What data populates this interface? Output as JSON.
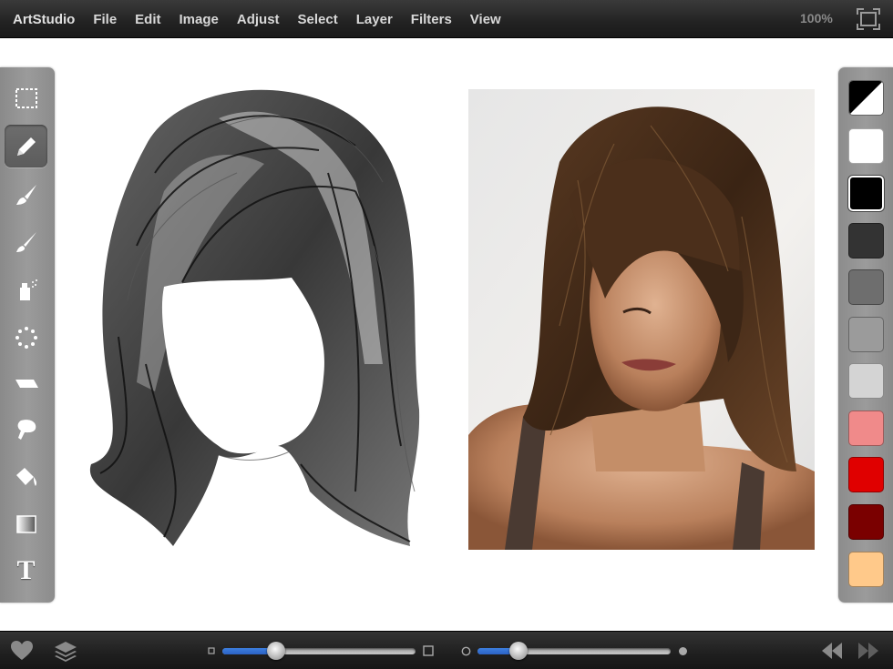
{
  "menubar": {
    "app_name": "ArtStudio",
    "items": [
      "File",
      "Edit",
      "Image",
      "Adjust",
      "Select",
      "Layer",
      "Filters",
      "View"
    ],
    "zoom": "100%",
    "fullscreen_icon": "fullscreen-icon"
  },
  "tools": [
    {
      "name": "selection-tool",
      "icon": "marquee-icon",
      "active": false
    },
    {
      "name": "pencil-tool",
      "icon": "pencil-icon",
      "active": true
    },
    {
      "name": "brush-tool",
      "icon": "brush-icon",
      "active": false
    },
    {
      "name": "smudge-brush-tool",
      "icon": "paintbrush-icon",
      "active": false
    },
    {
      "name": "spray-tool",
      "icon": "spray-can-icon",
      "active": false
    },
    {
      "name": "scatter-tool",
      "icon": "scatter-dots-icon",
      "active": false
    },
    {
      "name": "eraser-tool",
      "icon": "eraser-icon",
      "active": false
    },
    {
      "name": "smudge-tool",
      "icon": "smudge-finger-icon",
      "active": false
    },
    {
      "name": "fill-tool",
      "icon": "paint-bucket-icon",
      "active": false
    },
    {
      "name": "gradient-tool",
      "icon": "gradient-icon",
      "active": false
    },
    {
      "name": "text-tool",
      "icon": "text-icon",
      "active": false,
      "glyph": "T"
    }
  ],
  "colors": {
    "current": [
      "#000000",
      "#ffffff"
    ],
    "swatches": [
      "#ffffff",
      "#000000",
      "#333333",
      "#6e6e6e",
      "#9b9b9b",
      "#d4d4d4",
      "#f08a8a",
      "#e00000",
      "#7a0000",
      "#ffc98a"
    ],
    "selected_index": 1
  },
  "bottombar": {
    "favorite_icon": "heart-icon",
    "layers_icon": "layers-icon",
    "size_slider": {
      "min_icon": "small-square-icon",
      "max_icon": "large-square-icon",
      "value": 0.28
    },
    "opacity_slider": {
      "min_icon": "hollow-circle-icon",
      "max_icon": "filled-circle-icon",
      "value": 0.21
    },
    "undo_icon": "rewind-icon",
    "redo_icon": "fast-forward-icon"
  },
  "canvas": {
    "sketch_label": "hair-sketch",
    "photo_label": "reference-photo"
  },
  "accent": "#2f6fd6"
}
